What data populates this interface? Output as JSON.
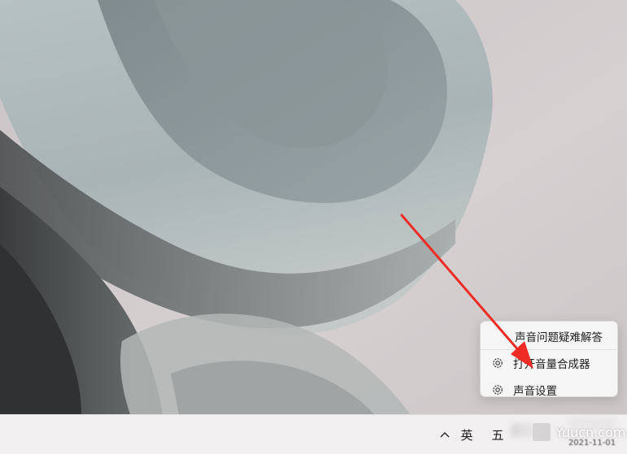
{
  "context_menu": {
    "items": [
      {
        "label": "声音问题疑难解答",
        "icon": "none"
      },
      {
        "label": "打开音量合成器",
        "icon": "gear-icon"
      },
      {
        "label": "声音设置",
        "icon": "gear-icon"
      }
    ]
  },
  "taskbar": {
    "chevron_icon": "chevron-up-icon",
    "chevron_glyph": "^",
    "language": "英",
    "ime": "五",
    "date": "2021-11-01"
  },
  "watermark": {
    "text": "Yuucn.com"
  },
  "annotation": {
    "color": "#ee2b24"
  },
  "colors": {
    "taskbar": "#f1efef",
    "menu": "#f6f5f5",
    "text": "#1d1d1d"
  }
}
